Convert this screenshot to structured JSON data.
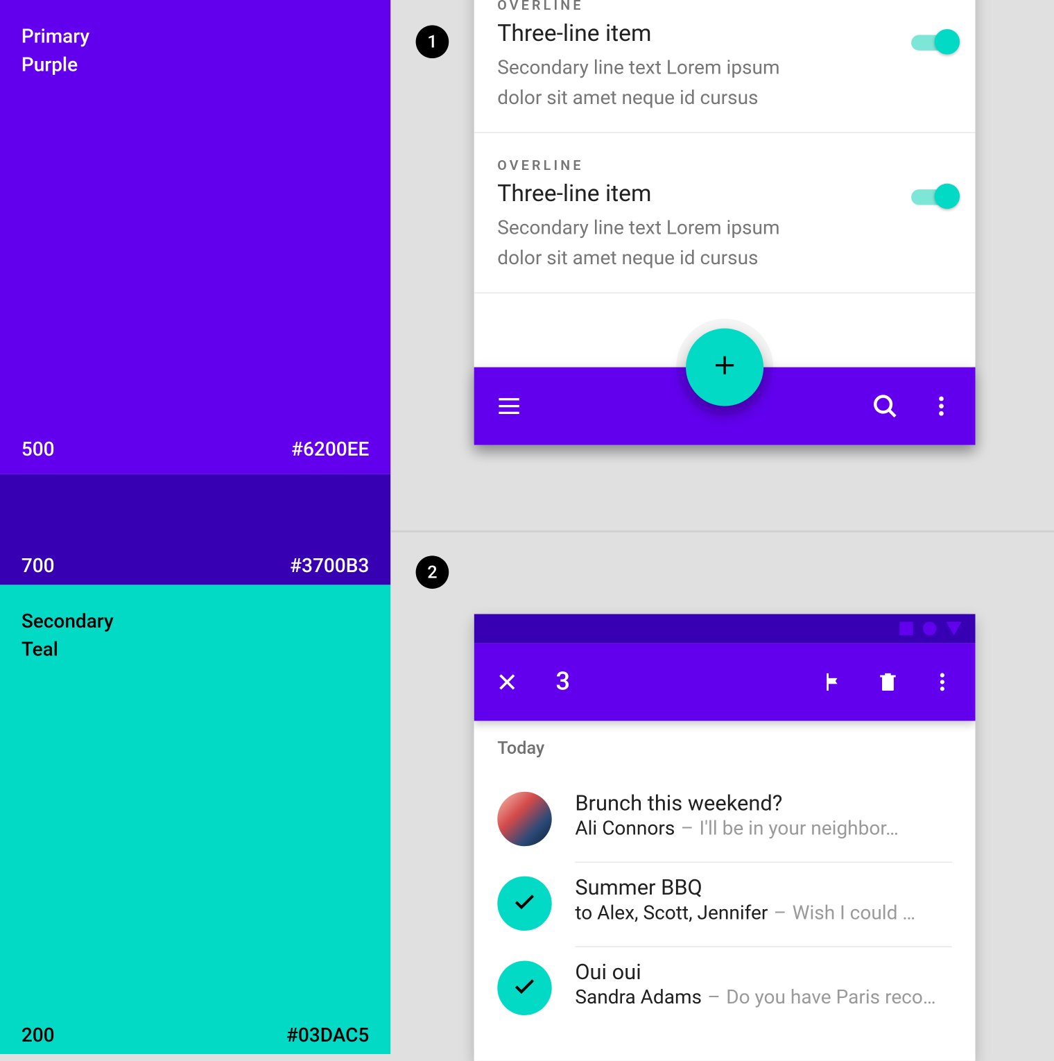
{
  "palette": {
    "primary_label": "Primary",
    "primary_name": "Purple",
    "primary_500_code": "500",
    "primary_500_hex": "#6200EE",
    "primary_700_code": "700",
    "primary_700_hex": "#3700B3",
    "secondary_label": "Secondary",
    "secondary_name": "Teal",
    "secondary_200_code": "200",
    "secondary_200_hex": "#03DAC5"
  },
  "badges": {
    "one": "1",
    "two": "2"
  },
  "example1": {
    "items": [
      {
        "overline": "OVERLINE",
        "title": "Three-line item",
        "secondary": "Secondary line text Lorem ipsum dolor sit amet neque id cursus"
      },
      {
        "overline": "OVERLINE",
        "title": "Three-line item",
        "secondary": "Secondary line text Lorem ipsum dolor sit amet neque id cursus"
      }
    ]
  },
  "example2": {
    "selected_count": "3",
    "section_label": "Today",
    "emails": [
      {
        "title": "Brunch this weekend?",
        "sender": "Ali Connors",
        "preview": "I'll be in your neighbor…",
        "selected": false
      },
      {
        "title": "Summer BBQ",
        "sender": "to Alex, Scott, Jennifer",
        "preview": "Wish I could  …",
        "selected": true
      },
      {
        "title": "Oui oui",
        "sender": "Sandra Adams",
        "preview": "Do you have Paris reco…",
        "selected": true
      }
    ]
  }
}
